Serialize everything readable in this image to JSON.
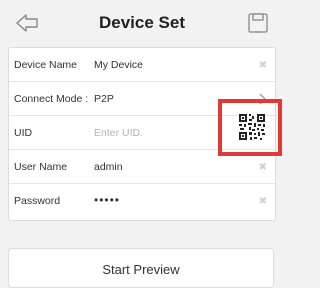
{
  "header": {
    "title": "Device Set",
    "back_icon": "back-arrow-icon",
    "save_icon": "save-icon"
  },
  "form": {
    "rows": [
      {
        "label": "Device Name",
        "value": "My Device",
        "placeholder": "",
        "action_icon": "clear-icon"
      },
      {
        "label": "Connect Mode",
        "colon": ":",
        "value": "P2P",
        "placeholder": "",
        "action_icon": "chevron-right-icon"
      },
      {
        "label": "UID",
        "value": "",
        "placeholder": "Enter UID.",
        "action_icon": "qr-code-icon"
      },
      {
        "label": "User Name",
        "value": "admin",
        "placeholder": "",
        "action_icon": "clear-icon"
      },
      {
        "label": "Password",
        "value": "•••••",
        "placeholder": "",
        "action_icon": "clear-icon"
      }
    ]
  },
  "highlight": {
    "color": "#e03a34",
    "target": "qr-code-icon"
  },
  "footer": {
    "start_preview_label": "Start Preview"
  }
}
